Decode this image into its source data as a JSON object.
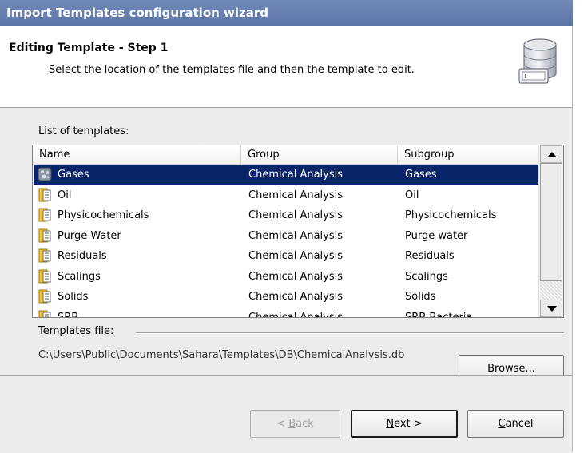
{
  "window": {
    "title": "Import Templates configuration wizard"
  },
  "header": {
    "title": "Editing Template - Step 1",
    "description": "Select the location of the templates file and then the template to edit."
  },
  "list": {
    "label": "List of templates:",
    "columns": [
      "Name",
      "Group",
      "Subgroup"
    ],
    "rows": [
      {
        "name": "Gases",
        "group": "Chemical Analysis",
        "subgroup": "Gases",
        "icon": "gases-template-icon",
        "selected": true
      },
      {
        "name": "Oil",
        "group": "Chemical Analysis",
        "subgroup": "Oil",
        "icon": "template-icon"
      },
      {
        "name": "Physicochemicals",
        "group": "Chemical Analysis",
        "subgroup": "Physicochemicals",
        "icon": "template-icon"
      },
      {
        "name": "Purge Water",
        "group": "Chemical Analysis",
        "subgroup": "Purge water",
        "icon": "template-icon"
      },
      {
        "name": "Residuals",
        "group": "Chemical Analysis",
        "subgroup": "Residuals",
        "icon": "template-icon"
      },
      {
        "name": "Scalings",
        "group": "Chemical Analysis",
        "subgroup": "Scalings",
        "icon": "template-icon"
      },
      {
        "name": "Solids",
        "group": "Chemical Analysis",
        "subgroup": "Solids",
        "icon": "template-icon"
      },
      {
        "name": "SRB",
        "group": "Chemical Analysis",
        "subgroup": "SRB Bacteria",
        "icon": "template-icon"
      }
    ]
  },
  "templates_file": {
    "label": "Templates file:",
    "path": "C:\\Users\\Public\\Documents\\Sahara\\Templates\\DB\\ChemicalAnalysis.db",
    "browse_label": "Browse..."
  },
  "footer": {
    "back_label": "< Back",
    "next_label": "Next >",
    "cancel_label": "Cancel"
  },
  "colors": {
    "titlebar": "#6781b1",
    "selection": "#0a246a",
    "dialog_bg": "#ececec"
  }
}
